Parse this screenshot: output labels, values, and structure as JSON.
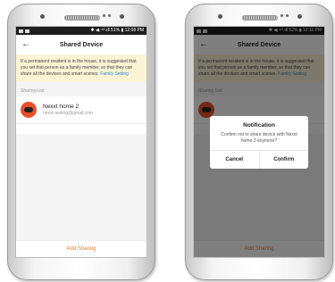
{
  "phone_left": {
    "status": {
      "right": "✱ ◀ᵢ ⁴ᴳ.ıll 51% ▮ 12:08 PM"
    },
    "nav": {
      "back_icon": "←",
      "title": "Shared Device"
    },
    "banner": {
      "text": "If a permanent resident is in the house, it is suggested that you set that person as a family member, so that they can share all the devices and smart scenes.",
      "link": "Family Setting"
    },
    "section_label": "Sharing List",
    "items": [
      {
        "name": "Nexxt home 2",
        "email": "nexxt.testing@gmail.com"
      }
    ],
    "add_button": "Add Sharing"
  },
  "phone_right": {
    "status": {
      "right": "✱ ◀ᵢ ⁴ᴳ.ıll 52% ▮ 12:11 PM"
    },
    "nav": {
      "back_icon": "←",
      "title": "Shared Device"
    },
    "banner": {
      "text": "If a permanent resident is in the house, it is suggested that you set that person as a family member, so that they can share all the devices and smart scenes.",
      "link": "Family Setting"
    },
    "section_label": "Sharing List",
    "add_button": "Add Sharing",
    "dialog": {
      "title": "Notification",
      "message": "Confirm not to share device with Nexxt home 2 anymore?",
      "cancel": "Cancel",
      "confirm": "Confirm"
    }
  },
  "colors": {
    "banner_bg": "#fbf3d4",
    "link": "#2a8ad6",
    "accent": "#f07a2b",
    "avatar": "#e8502b"
  }
}
